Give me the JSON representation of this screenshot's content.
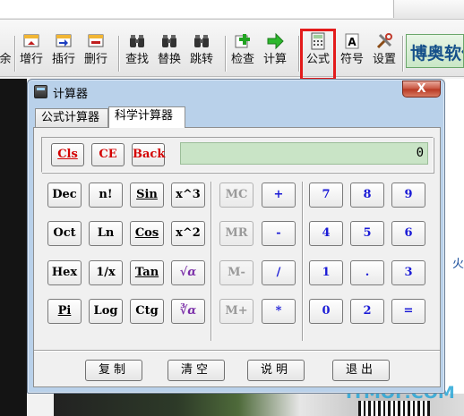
{
  "toolbar": {
    "items": [
      {
        "label": "余",
        "icon": "cut-off-icon"
      },
      {
        "label": "增行",
        "icon": "add-row-icon"
      },
      {
        "label": "插行",
        "icon": "insert-row-icon"
      },
      {
        "label": "删行",
        "icon": "delete-row-icon"
      },
      {
        "label": "查找",
        "icon": "binoculars-icon"
      },
      {
        "label": "替换",
        "icon": "binoculars-replace-icon"
      },
      {
        "label": "跳转",
        "icon": "binoculars-jump-icon"
      },
      {
        "label": "检查",
        "icon": "check-plus-icon"
      },
      {
        "label": "计算",
        "icon": "green-arrow-icon"
      },
      {
        "label": "公式",
        "icon": "calculator-icon"
      },
      {
        "label": "符号",
        "icon": "symbol-a-icon"
      },
      {
        "label": "设置",
        "icon": "tools-icon"
      }
    ],
    "brand": "博奥软件"
  },
  "background": {
    "watermark": "ITMOP.COM",
    "right_mark": "火"
  },
  "calculator": {
    "title": "计算器",
    "close_label": "X",
    "tabs": [
      {
        "label": "公式计算器",
        "active": false
      },
      {
        "label": "科学计算器",
        "active": true
      }
    ],
    "top_buttons": [
      "Cls",
      "CE",
      "Back"
    ],
    "display_value": "0",
    "function_keys": [
      [
        "Dec",
        "n!",
        "Sin",
        "x^3"
      ],
      [
        "Oct",
        "Ln",
        "Cos",
        "x^2"
      ],
      [
        "Hex",
        "1/x",
        "Tan",
        "√α"
      ],
      [
        "Pi",
        "Log",
        "Ctg",
        "∛α"
      ]
    ],
    "memory_keys": [
      "MC",
      "MR",
      "M-",
      "M+"
    ],
    "operator_keys": [
      "+",
      "-",
      "/",
      "*"
    ],
    "digit_keys": [
      [
        "7",
        "8",
        "9"
      ],
      [
        "4",
        "5",
        "6"
      ],
      [
        "1",
        ".",
        "3"
      ],
      [
        "0",
        "2",
        "="
      ]
    ],
    "footer_buttons": [
      "复制",
      "清空",
      "说明",
      "退出"
    ],
    "colors": {
      "display_bg": "#c9e4c6",
      "red_text": "#d40000",
      "blue_text": "#1b1bd6",
      "disabled_text": "#9a9a9a",
      "highlight_box": "#e31b1b"
    }
  }
}
